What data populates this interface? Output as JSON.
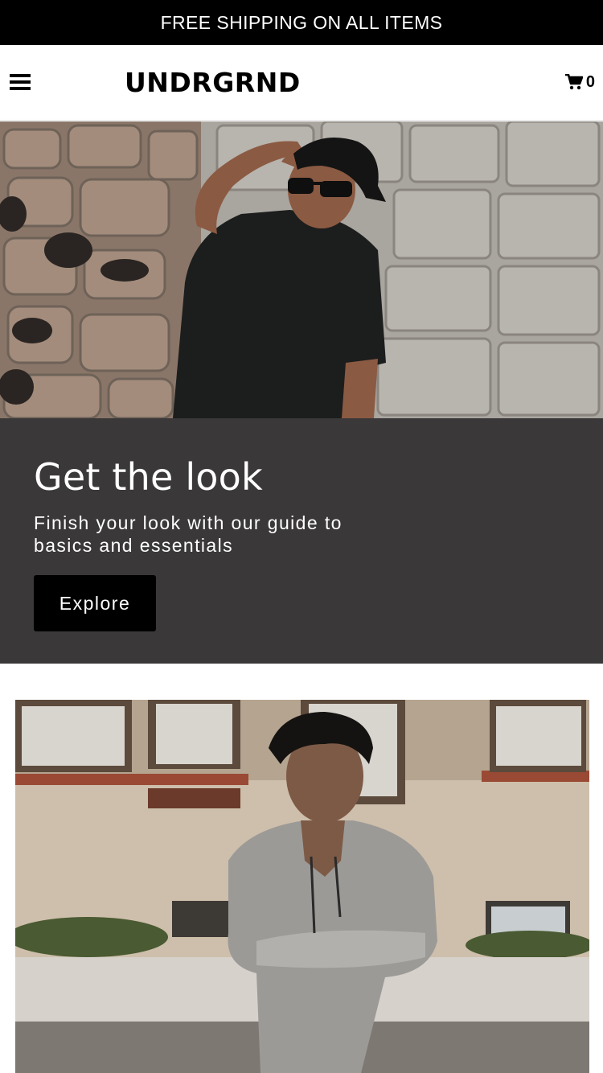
{
  "announcement": {
    "text": "FREE SHIPPING ON ALL ITEMS"
  },
  "header": {
    "logo": "UNDRGRND",
    "menu_icon": "hamburger-menu-icon",
    "cart_icon": "cart-icon",
    "cart_count": "0"
  },
  "hero1": {
    "image": "man-black-tshirt-cap-sunglasses-stone-wall"
  },
  "promo": {
    "title": "Get the look",
    "subtitle": "Finish your look with our guide to basics and essentials",
    "button_label": "Explore"
  },
  "hero2": {
    "image": "man-grey-henley-hoodie-arms-crossed-street"
  },
  "colors": {
    "announcement_bg": "#000000",
    "promo_bg": "#3a3839",
    "button_bg": "#000000"
  }
}
